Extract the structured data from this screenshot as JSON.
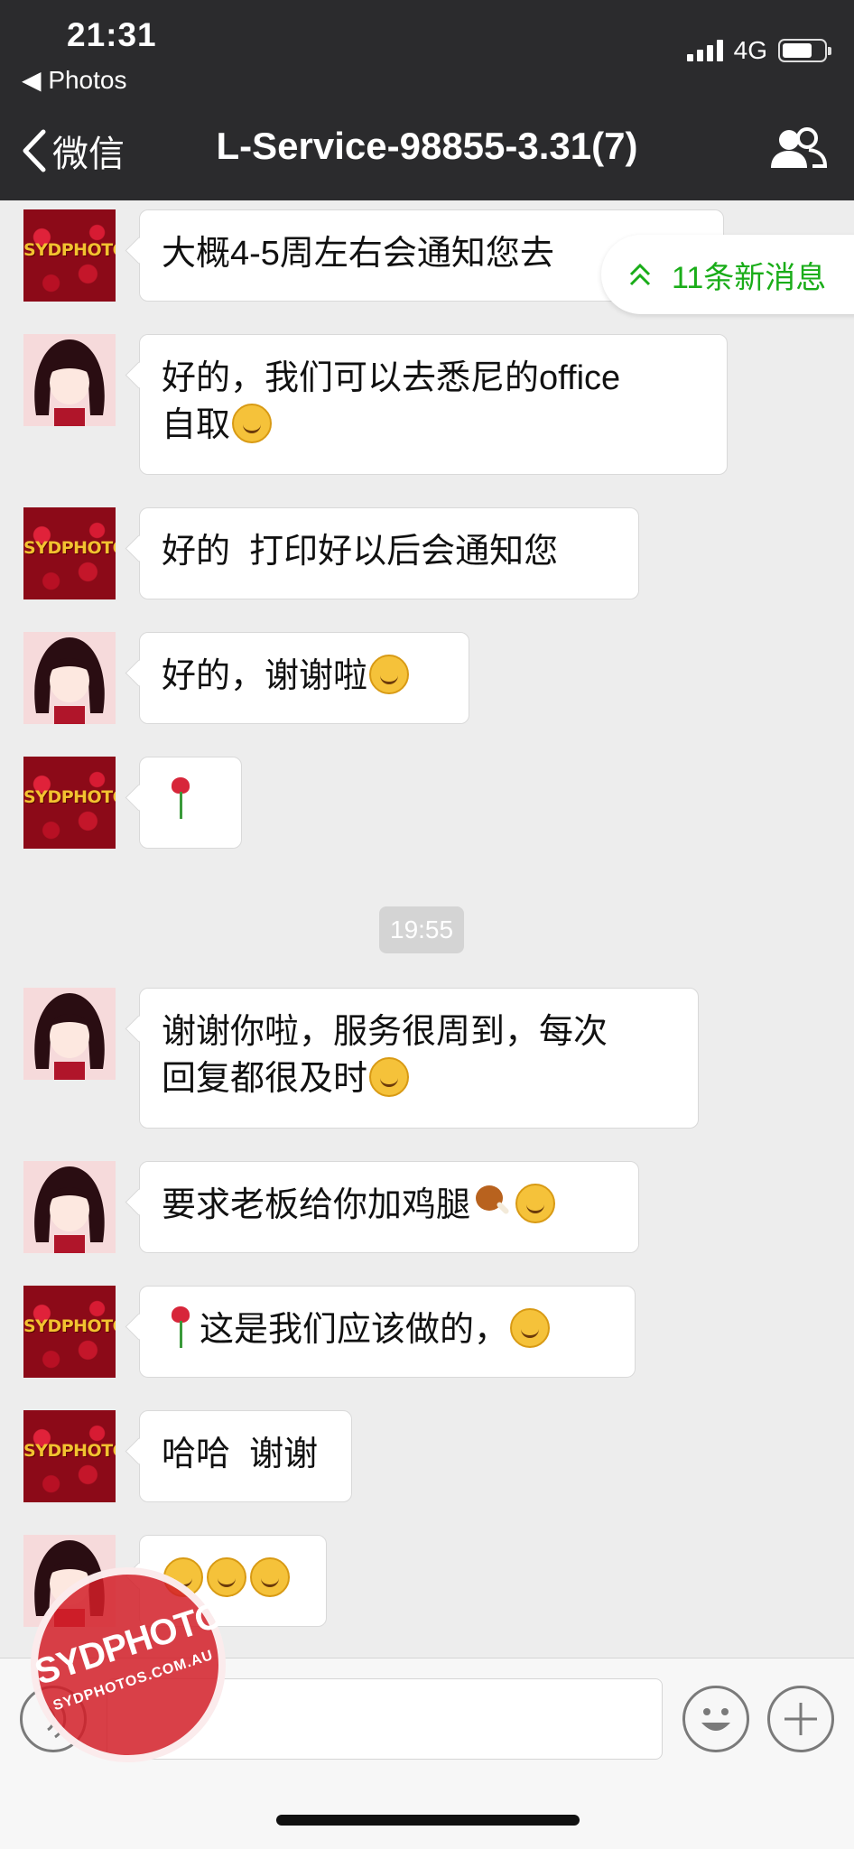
{
  "status_bar": {
    "time": "21:31",
    "back_app": "◀ Photos",
    "network": "4G",
    "battery_level": 0.72
  },
  "nav": {
    "back_label": "微信",
    "title": "L-Service-98855-3.31(7)",
    "right_icon": "group-members-icon"
  },
  "new_messages_banner": "11条新消息",
  "timestamp": "19:55",
  "messages": [
    {
      "sender": "brand",
      "text": "大概4-5周左右会通知您去"
    },
    {
      "sender": "girl",
      "text": "好的，我们可以去悉尼的office\n自取"
    },
    {
      "sender": "brand",
      "text": "好的  打印好以后会通知您"
    },
    {
      "sender": "girl",
      "text": "好的，谢谢啦"
    },
    {
      "sender": "brand",
      "text": ""
    },
    {
      "sender": "girl",
      "text": "谢谢你啦，服务很周到，每次\n回复都很及时"
    },
    {
      "sender": "girl",
      "text": "要求老板给你加鸡腿"
    },
    {
      "sender": "brand",
      "text": "这是我们应该做的，"
    },
    {
      "sender": "brand",
      "text": "哈哈  谢谢"
    },
    {
      "sender": "girl",
      "text": ""
    }
  ],
  "brand_avatar_text": "SYDPHOTOS",
  "watermark": {
    "main": "SYDPHOTOS",
    "sub": "SYDPHOTOS.COM.AU"
  },
  "colors": {
    "header_bg": "#2b2b2d",
    "chat_bg": "#ededed",
    "accent_green": "#1aad19"
  }
}
